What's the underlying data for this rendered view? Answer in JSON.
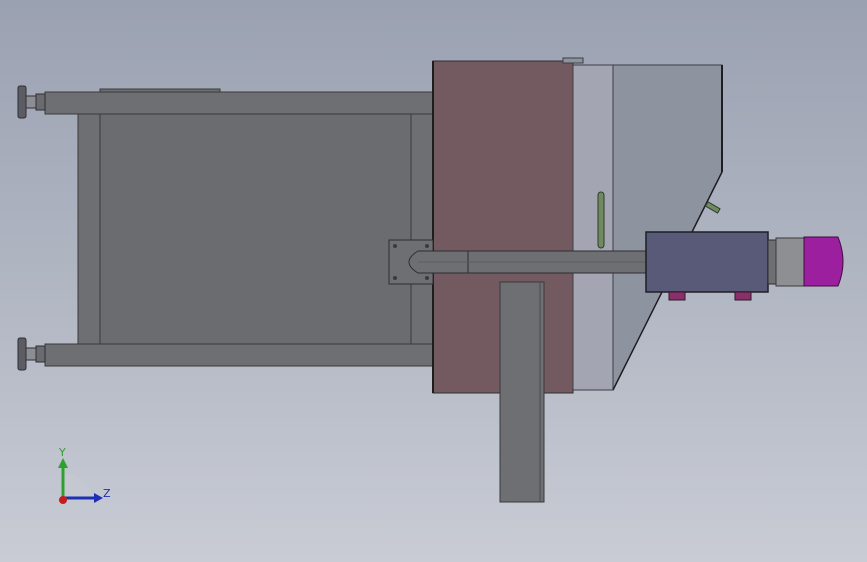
{
  "viewport": {
    "background_top": "#9aa1b1",
    "background_bottom": "#c9ccd5"
  },
  "colors": {
    "frame": "#6e6f72",
    "frame_edge": "#3a3a3a",
    "hopper_panel": "#735a60",
    "glass_light": "#a3a6b2",
    "glass_dark": "#8e93a0",
    "motor_housing": "#585a78",
    "motor_cap": "#9b1f9e",
    "motor_ring": "#8e8f92",
    "foot": "#5c5c64",
    "handle": "#6f8a5e",
    "pad": "#8a2f6a"
  },
  "triad": {
    "y_label": "Y",
    "z_label": "Z",
    "y_color": "#2fa02f",
    "z_color": "#1c2fb5",
    "x_color": "#c41d1d"
  }
}
